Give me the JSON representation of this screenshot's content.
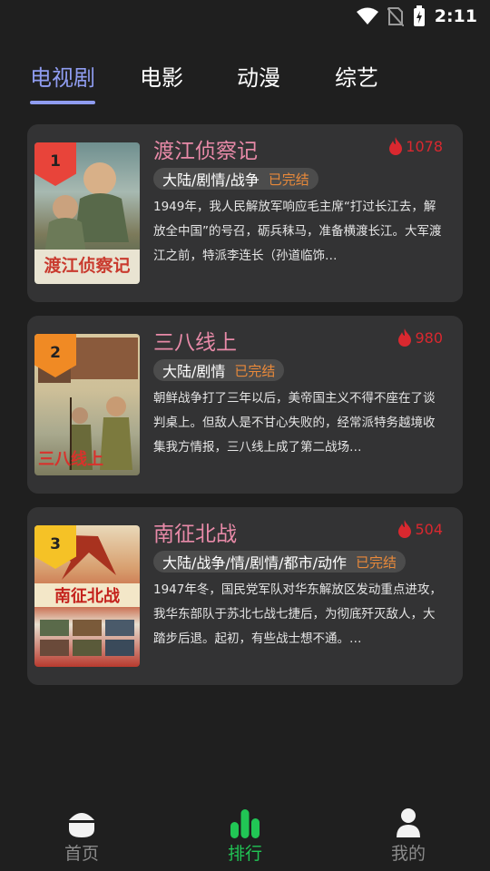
{
  "status": {
    "time": "2:11"
  },
  "tabs": [
    {
      "label": "电视剧",
      "active": true
    },
    {
      "label": "电影"
    },
    {
      "label": "动漫"
    },
    {
      "label": "综艺"
    }
  ],
  "list": [
    {
      "rank": "1",
      "rank_color": "#e8443a",
      "title": "渡江侦察记",
      "hot": "1078",
      "genre": "大陆/剧情/战争",
      "status": "已完结",
      "desc": "1949年，我人民解放军响应毛主席“打过长江去，解放全中国”的号召，砺兵秣马，准备横渡长江。大军渡江之前，特派李连长（孙道临饰…",
      "poster_text": "渡江侦察记"
    },
    {
      "rank": "2",
      "rank_color": "#f08a24",
      "title": "三八线上",
      "hot": "980",
      "genre": "大陆/剧情",
      "status": "已完结",
      "desc": "朝鲜战争打了三年以后，美帝国主义不得不座在了谈判桌上。但敌人是不甘心失败的，经常派特务越境收集我方情报，三八线上成了第二战场…",
      "poster_text": "三八线上"
    },
    {
      "rank": "3",
      "rank_color": "#f5c226",
      "title": "南征北战",
      "hot": "504",
      "genre": "大陆/战争/情/剧情/都市/动作",
      "status": "已完结",
      "desc": "1947年冬，国民党军队对华东解放区发动重点进攻，我华东部队于苏北七战七捷后，为彻底歼灭敌人，大踏步后退。起初，有些战士想不通。…",
      "poster_text": "南征北战"
    }
  ],
  "nav": [
    {
      "label": "首页",
      "icon": "home-icon"
    },
    {
      "label": "排行",
      "icon": "ranking-icon",
      "active": true
    },
    {
      "label": "我的",
      "icon": "profile-icon"
    }
  ]
}
